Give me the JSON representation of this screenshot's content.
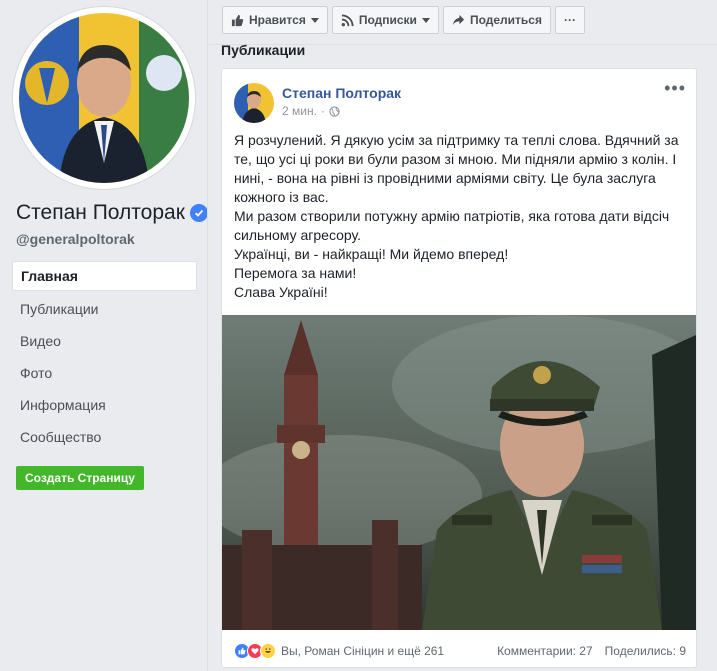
{
  "page": {
    "name": "Степан Полторак",
    "handle": "@generalpoltorak"
  },
  "nav": {
    "items": [
      {
        "label": "Главная",
        "active": true
      },
      {
        "label": "Публикации"
      },
      {
        "label": "Видео"
      },
      {
        "label": "Фото"
      },
      {
        "label": "Информация"
      },
      {
        "label": "Сообщество"
      }
    ],
    "create_page": "Создать Страницу"
  },
  "actions": {
    "like": "Нравится",
    "follow": "Подписки",
    "share": "Поделиться",
    "more": "···"
  },
  "section_title": "Публикации",
  "post": {
    "author": "Степан Полторак",
    "time": "2 мин.",
    "more": "•••",
    "paragraphs": [
      "Я розчулений. Я дякую усім за підтримку та теплі слова. Вдячний за те, що усі ці роки ви були разом зі мною. Ми підняли армію з колін. І нині, - вона на рівні із провідними арміями світу. Це була заслуга кожного із вас.",
      "Ми разом створили потужну армію патріотів, яка готова дати відсіч сильному агресору.",
      "Українці, ви - найкращі! Ми йдемо вперед!",
      "Перемога за нами!",
      "Слава Україні!"
    ],
    "reactions_text": "Вы, Роман Сініцин и ещё 261",
    "comments": "Комментарии: 27",
    "shares": "Поделились: 9"
  },
  "colors": {
    "link": "#365899",
    "accent_green": "#42b72a",
    "verified": "#4080ff"
  }
}
